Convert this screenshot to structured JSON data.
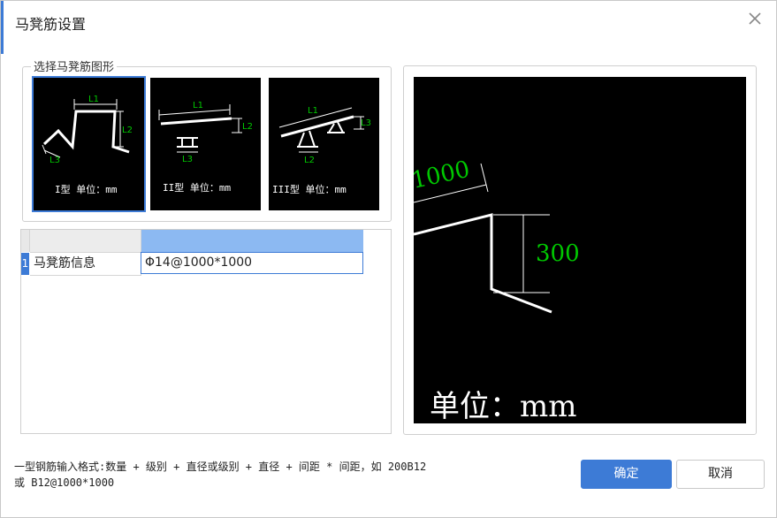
{
  "dialog": {
    "title": "马凳筋设置",
    "close_icon": "close-icon"
  },
  "shape_group": {
    "legend": "选择马凳筋图形",
    "shapes": [
      {
        "caption": "I型 单位：mm",
        "labels": [
          "L1",
          "L2",
          "L3"
        ],
        "selected": true
      },
      {
        "caption": "II型 单位：mm",
        "labels": [
          "L1",
          "L2",
          "L3"
        ],
        "selected": false
      },
      {
        "caption": "III型 单位：mm",
        "labels": [
          "L1",
          "L3",
          "L2"
        ],
        "selected": false
      }
    ]
  },
  "grid": {
    "rows": [
      {
        "num": "1",
        "name": "马凳筋信息",
        "value": "Φ14@1000*1000"
      }
    ]
  },
  "preview": {
    "dim_l1": "1000",
    "dim_l2": "300",
    "unit": "单位：mm"
  },
  "hint": {
    "line1": "一型钢筋输入格式:数量 + 级别 + 直径或级别 + 直径 + 间距 * 间距，如 200B12",
    "line2": "或 B12@1000*1000"
  },
  "buttons": {
    "ok": "确定",
    "cancel": "取消"
  },
  "colors": {
    "accent": "#3d7bd6",
    "dimension_text": "#00c800",
    "drawing_bg": "#000000"
  }
}
